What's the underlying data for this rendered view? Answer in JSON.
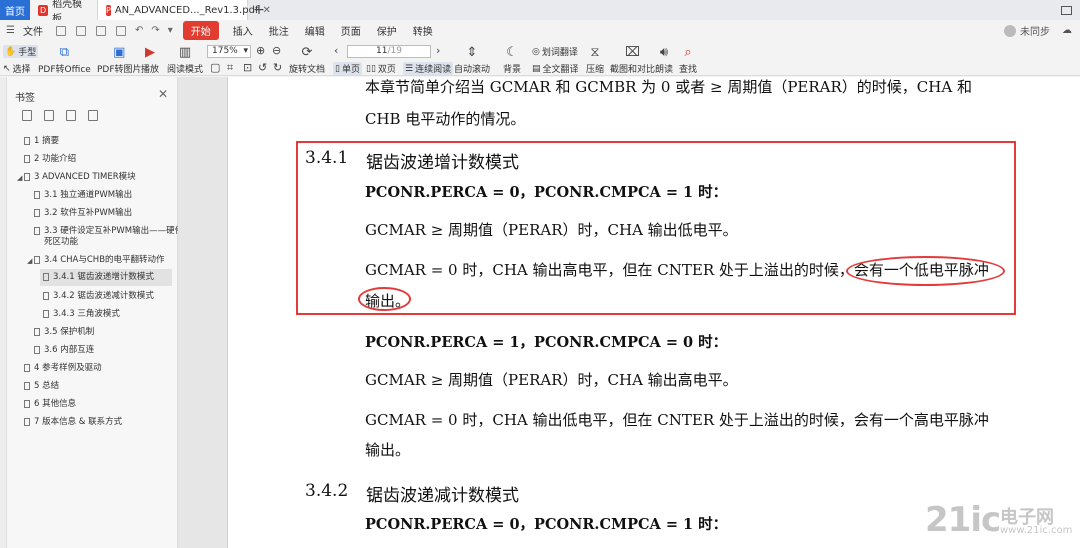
{
  "tabs": {
    "home": "首页",
    "items": [
      {
        "label": "稻壳模板"
      },
      {
        "label": "AN_ADVANCED..._Rev1.3.pdf"
      }
    ],
    "add": "+"
  },
  "menu": {
    "file": "文件",
    "start": "开始",
    "items": [
      "插入",
      "批注",
      "编辑",
      "页面",
      "保护",
      "转换"
    ],
    "sync": "未同步"
  },
  "toolbar": {
    "hand": "手型",
    "select": "选择",
    "pdf_to_office": "PDF转Office",
    "pdf_to_image": "PDF转图片",
    "play": "播放",
    "read_mode": "阅读模式",
    "zoom": "175%",
    "rotate": "旋转文档",
    "single": "单页",
    "double": "双页",
    "continuous": "连续阅读",
    "page_current": "11",
    "page_total": "/19",
    "auto_scroll": "自动滚动",
    "background": "背景",
    "word_translate": "划词翻译",
    "full_translate": "全文翻译",
    "compress": "压缩",
    "screenshot_compare": "截图和对比",
    "read_aloud": "朗读",
    "find": "查找"
  },
  "sidebar": {
    "title": "书签",
    "items": [
      {
        "label": "1 摘要"
      },
      {
        "label": "2 功能介绍"
      },
      {
        "label": "3 ADVANCED TIMER模块"
      },
      {
        "label": "3.1 独立通道PWM输出"
      },
      {
        "label": "3.2  软件互补PWM输出"
      },
      {
        "label": "3.3 硬件设定互补PWM输出——硬件"
      },
      {
        "label": "死区功能"
      },
      {
        "label": "3.4 CHA与CHB的电平翻转动作"
      },
      {
        "label": "3.4.1 锯齿波递增计数模式"
      },
      {
        "label": "3.4.2 锯齿波递减计数模式"
      },
      {
        "label": "3.4.3 三角波模式"
      },
      {
        "label": "3.5 保护机制"
      },
      {
        "label": "3.6 内部互连"
      },
      {
        "label": "4 参考样例及驱动"
      },
      {
        "label": "5 总结"
      },
      {
        "label": "6 其他信息"
      },
      {
        "label": "7 版本信息 & 联系方式"
      }
    ]
  },
  "doc": {
    "intro1": "本章节简单介绍当 GCMAR 和 GCMBR 为 0 或者 ≥ 周期值（PERAR）的时候，CHA 和",
    "intro2": "CHB 电平动作的情况。",
    "s1_num": "3.4.1",
    "s1_title": "锯齿波递增计数模式",
    "c1": "PCONR.PERCA = 0，PCONR.CMPCA = 1 时：",
    "c1a": "GCMAR ≥ 周期值（PERAR）时，CHA 输出低电平。",
    "c1b": "GCMAR = 0 时，CHA 输出高电平，但在 CNTER 处于上溢出的时候，会有一个低电平脉冲",
    "c1c": "输出。",
    "c2": "PCONR.PERCA = 1，PCONR.CMPCA = 0 时：",
    "c2a": "GCMAR ≥ 周期值（PERAR）时，CHA 输出高电平。",
    "c2b": "GCMAR = 0 时，CHA 输出低电平，但在 CNTER 处于上溢出的时候，会有一个高电平脉冲",
    "c2c": "输出。",
    "s2_num": "3.4.2",
    "s2_title": "锯齿波递减计数模式",
    "c3": "PCONR.PERCA = 0，PCONR.CMPCA = 1 时："
  },
  "watermark": {
    "brand": "21ic",
    "cn": "电子网",
    "url": "www.21ic.com"
  }
}
